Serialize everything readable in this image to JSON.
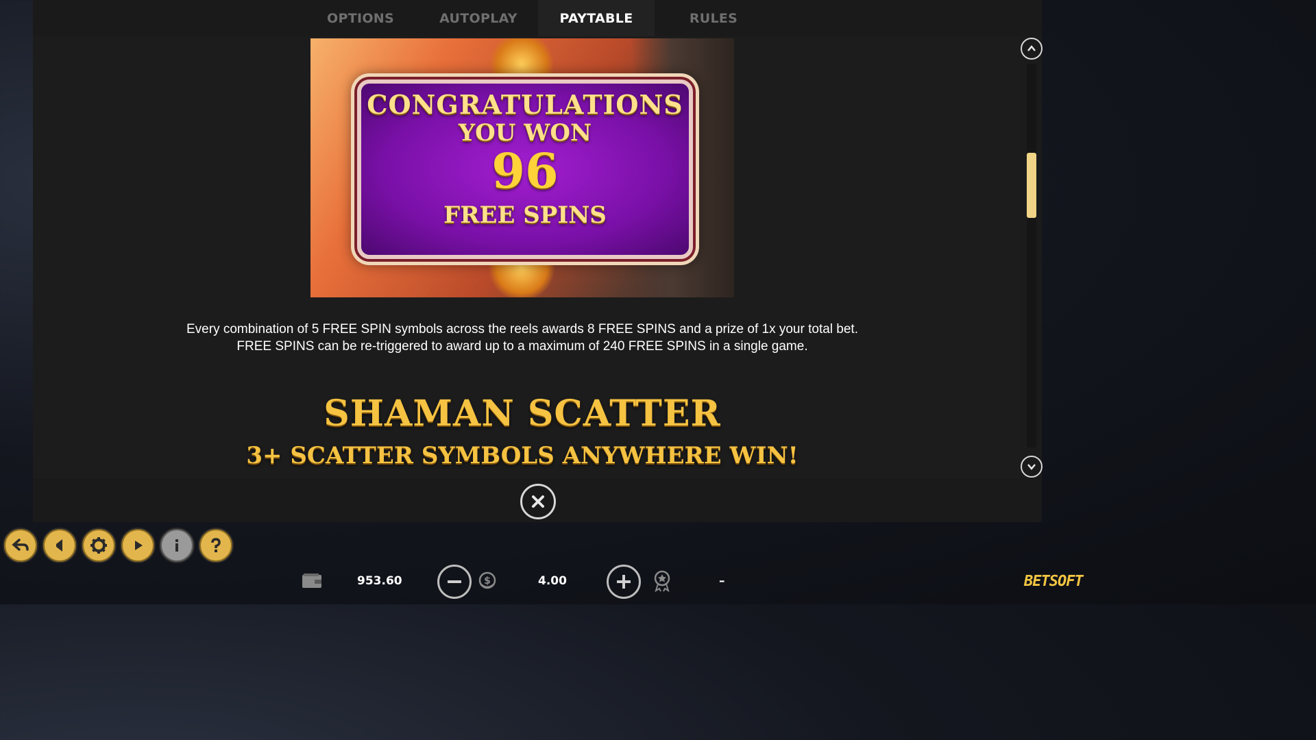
{
  "tabs": [
    {
      "label": "OPTIONS",
      "active": false
    },
    {
      "label": "AUTOPLAY",
      "active": false
    },
    {
      "label": "PAYTABLE",
      "active": true
    },
    {
      "label": "RULES",
      "active": false
    }
  ],
  "banner": {
    "line1": "CONGRATULATIONS",
    "line2": "YOU WON",
    "line3": "96",
    "line4": "FREE SPINS"
  },
  "description": {
    "line1": "Every combination of 5 FREE SPIN symbols across the reels awards 8 FREE SPINS and a prize of 1x your total bet.",
    "line2": "FREE SPINS can be re-triggered to award up to a maximum of 240 FREE SPINS in a single game."
  },
  "section": {
    "title": "SHAMAN SCATTER",
    "subtitle": "3+ SCATTER SYMBOLS ANYWHERE WIN!"
  },
  "scroll": {
    "position_fraction": 0.28,
    "thumb_fraction": 0.17
  },
  "controls": [
    "back-icon",
    "sound-icon",
    "settings-icon",
    "autoplay-icon",
    "info-icon",
    "help-icon"
  ],
  "status_bar": {
    "balance": "953.60",
    "bet": "4.00",
    "win": "–"
  },
  "brand": {
    "logo": "BETSOFT"
  },
  "colors": {
    "accent": "#f2d487",
    "gold": "#e2b64c",
    "active_tab_bg": "#222222"
  }
}
